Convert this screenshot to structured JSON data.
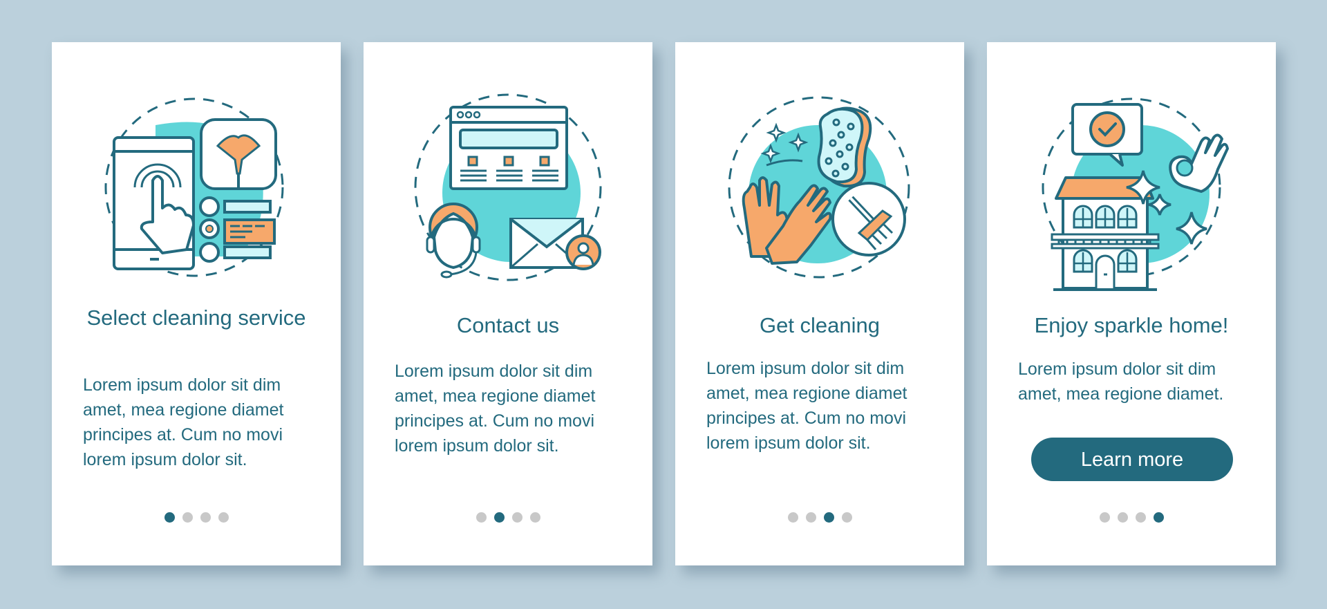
{
  "colors": {
    "background": "#bbd0dc",
    "card": "#ffffff",
    "primary": "#236a7e",
    "accent_teal": "#5fd5d8",
    "accent_orange": "#f6a86b",
    "accent_light": "#cff6f9",
    "dot_inactive": "#c8c8c8"
  },
  "cards": [
    {
      "illustration": "tablet-tap-duster-options-icon",
      "title": "Select cleaning service",
      "body": "Lorem ipsum dolor sit dim amet, mea regione diamet principes at. Cum no movi lorem ipsum dolor sit.",
      "page_index": 1
    },
    {
      "illustration": "browser-support-mail-icon",
      "title": "Contact us",
      "body": "Lorem ipsum dolor sit dim amet, mea regione diamet principes at. Cum no movi lorem ipsum dolor sit.",
      "page_index": 2
    },
    {
      "illustration": "gloves-sponge-brush-icon",
      "title": "Get cleaning",
      "body": "Lorem ipsum dolor sit dim amet, mea regione diamet principes at. Cum no movi lorem ipsum dolor sit.",
      "page_index": 3
    },
    {
      "illustration": "house-sparkle-ok-icon",
      "title": "Enjoy sparkle home!",
      "body": "Lorem ipsum dolor sit dim amet, mea regione diamet.",
      "button_label": "Learn more",
      "page_index": 4
    }
  ],
  "pagination": {
    "total": 4
  }
}
